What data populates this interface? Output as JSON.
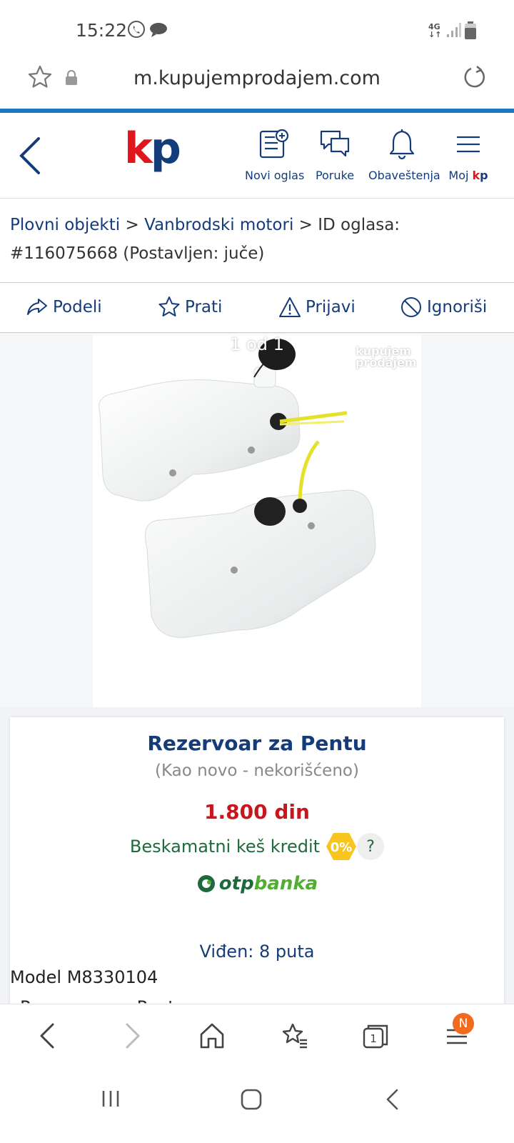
{
  "status_bar": {
    "time": "15:22",
    "network": "4G",
    "icons": [
      "viber-icon",
      "chat-bubble-icon",
      "signal-icon",
      "battery-icon"
    ]
  },
  "browser": {
    "url": "m.kupujemprodajem.com",
    "tab_count": "1",
    "menu_badge": "N"
  },
  "header": {
    "logo_k": "k",
    "logo_p": "p",
    "nav": [
      {
        "label": "Novi oglas",
        "icon": "new-listing-icon"
      },
      {
        "label": "Poruke",
        "icon": "messages-icon"
      },
      {
        "label": "Obaveštenja",
        "icon": "bell-icon"
      },
      {
        "label_prefix": "Moj ",
        "label_k": "k",
        "label_p": "p",
        "icon": "hamburger-menu-icon"
      }
    ]
  },
  "breadcrumb": {
    "cat1": "Plovni objekti",
    "sep1": " > ",
    "cat2": "Vanbrodski motori",
    "sep2": " > ",
    "id_text": "ID oglasa: #116075668 (Postavljen: juče)"
  },
  "actions": {
    "share": "Podeli",
    "follow": "Prati",
    "report": "Prijavi",
    "ignore": "Ignoriši"
  },
  "gallery": {
    "counter": "1 od 1",
    "watermark_line1": "kupujem",
    "watermark_line2": "prodajem"
  },
  "listing": {
    "title": "Rezervoar za Pentu",
    "condition": "(Kao novo - nekorišćeno)",
    "price": "1.800 din",
    "credit_text": "Beskamatni keš kredit",
    "credit_badge": "0%",
    "help": "?",
    "bank_prefix": "otp",
    "bank_suffix": "banka",
    "views": "Viđen: 8 puta",
    "model": "Model M8330104",
    "next_line": "Rezervoar za Pentu"
  },
  "colors": {
    "brand_blue": "#143c7a",
    "brand_red": "#e1161c",
    "price_red": "#c8161d",
    "credit_green": "#1e6a3c",
    "badge_yellow": "#f7c51e",
    "accent_line": "#1b79c4"
  }
}
